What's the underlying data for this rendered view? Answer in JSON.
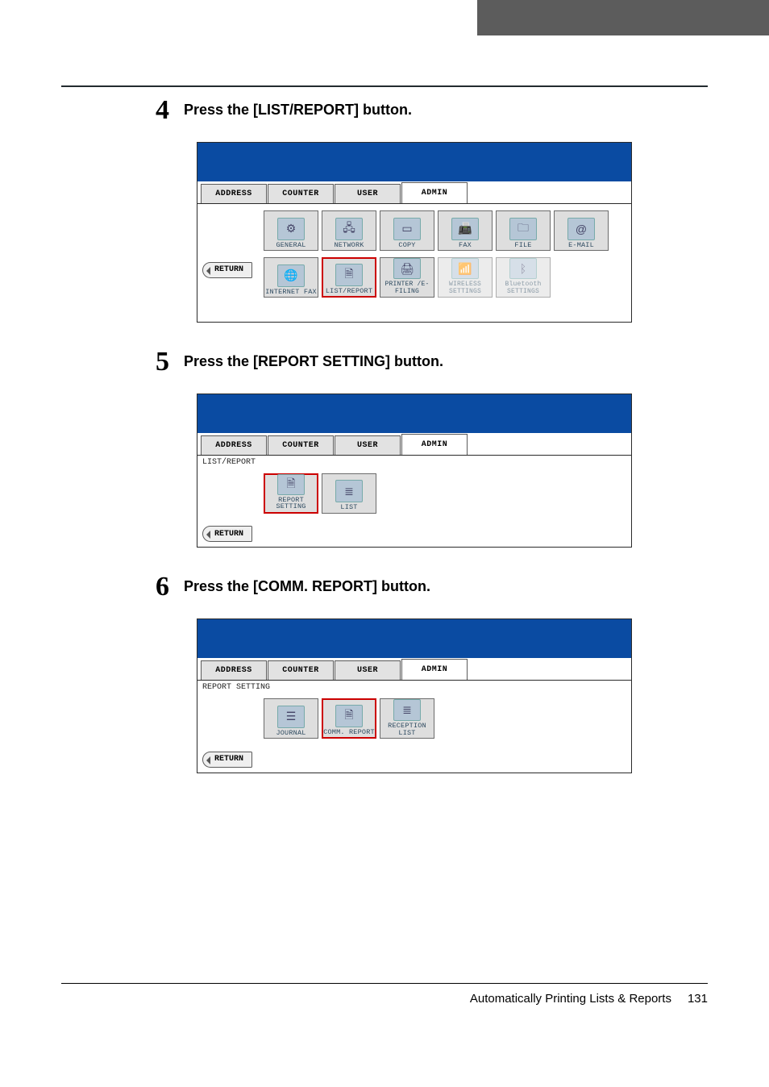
{
  "steps": {
    "s4": {
      "num": "4",
      "text": "Press the [LIST/REPORT] button."
    },
    "s5": {
      "num": "5",
      "text": "Press the [REPORT SETTING] button."
    },
    "s6": {
      "num": "6",
      "text": "Press the [COMM. REPORT] button."
    }
  },
  "tabs": {
    "address": "ADDRESS",
    "counter": "COUNTER",
    "user": "USER",
    "admin": "ADMIN"
  },
  "panel4": {
    "row1": {
      "general": "GENERAL",
      "network": "NETWORK",
      "copy": "COPY",
      "fax": "FAX",
      "file": "FILE",
      "email": "E-MAIL"
    },
    "row2": {
      "ifax": "INTERNET FAX",
      "listreport": "LIST/REPORT",
      "printer": "PRINTER\n/E-FILING",
      "wireless": "WIRELESS\nSETTINGS",
      "bluetooth": "Bluetooth\nSETTINGS"
    },
    "return": "RETURN"
  },
  "panel5": {
    "breadcrumb": "LIST/REPORT",
    "row1": {
      "reportsetting": "REPORT SETTING",
      "list": "LIST"
    },
    "return": "RETURN"
  },
  "panel6": {
    "breadcrumb": "REPORT SETTING",
    "row1": {
      "journal": "JOURNAL",
      "commreport": "COMM. REPORT",
      "reception": "RECEPTION LIST"
    },
    "return": "RETURN"
  },
  "footer": {
    "title": "Automatically Printing Lists & Reports",
    "page": "131"
  }
}
